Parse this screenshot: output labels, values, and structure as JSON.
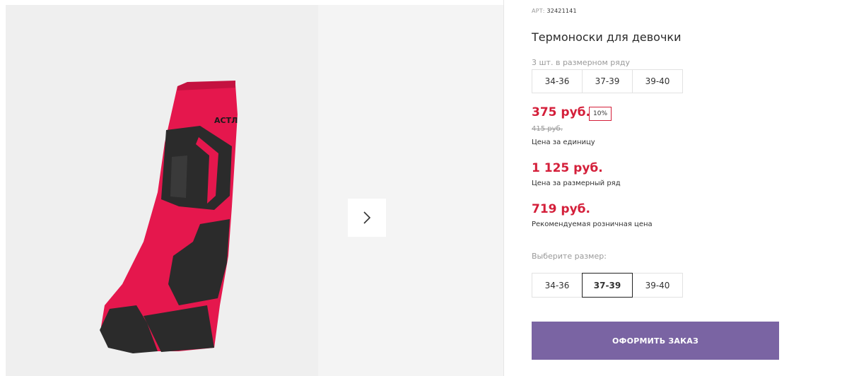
{
  "product": {
    "article_label": "АРТ:",
    "article": "32421141",
    "title": "Термоноски для девочки",
    "pack_label": "3 шт. в размерном ряду",
    "pack_sizes": [
      "34-36",
      "37-39",
      "39-40"
    ]
  },
  "gallery": {
    "image_icon": "sock-product-image",
    "image_print": "АСТЛ",
    "next_icon": "chevron-right-icon"
  },
  "pricing": {
    "unit_price": "375 руб.",
    "discount": "10%",
    "old_price": "415 руб.",
    "unit_price_label": "Цена за единицу",
    "row_price": "1 125 руб.",
    "row_price_label": "Цена за размерный ряд",
    "rrp": "719 руб.",
    "rrp_label": "Рекомендуемая розничная цена"
  },
  "size_selector": {
    "label": "Выберите размер:",
    "options": [
      "34-36",
      "37-39",
      "39-40"
    ],
    "selected": "37-39"
  },
  "actions": {
    "order_label": "ОФОРМИТЬ ЗАКАЗ"
  },
  "colors": {
    "price_red": "#d41f3a",
    "order_button": "#7a64a3",
    "sock_pink": "#e5174d",
    "sock_black": "#2b2b2b"
  }
}
